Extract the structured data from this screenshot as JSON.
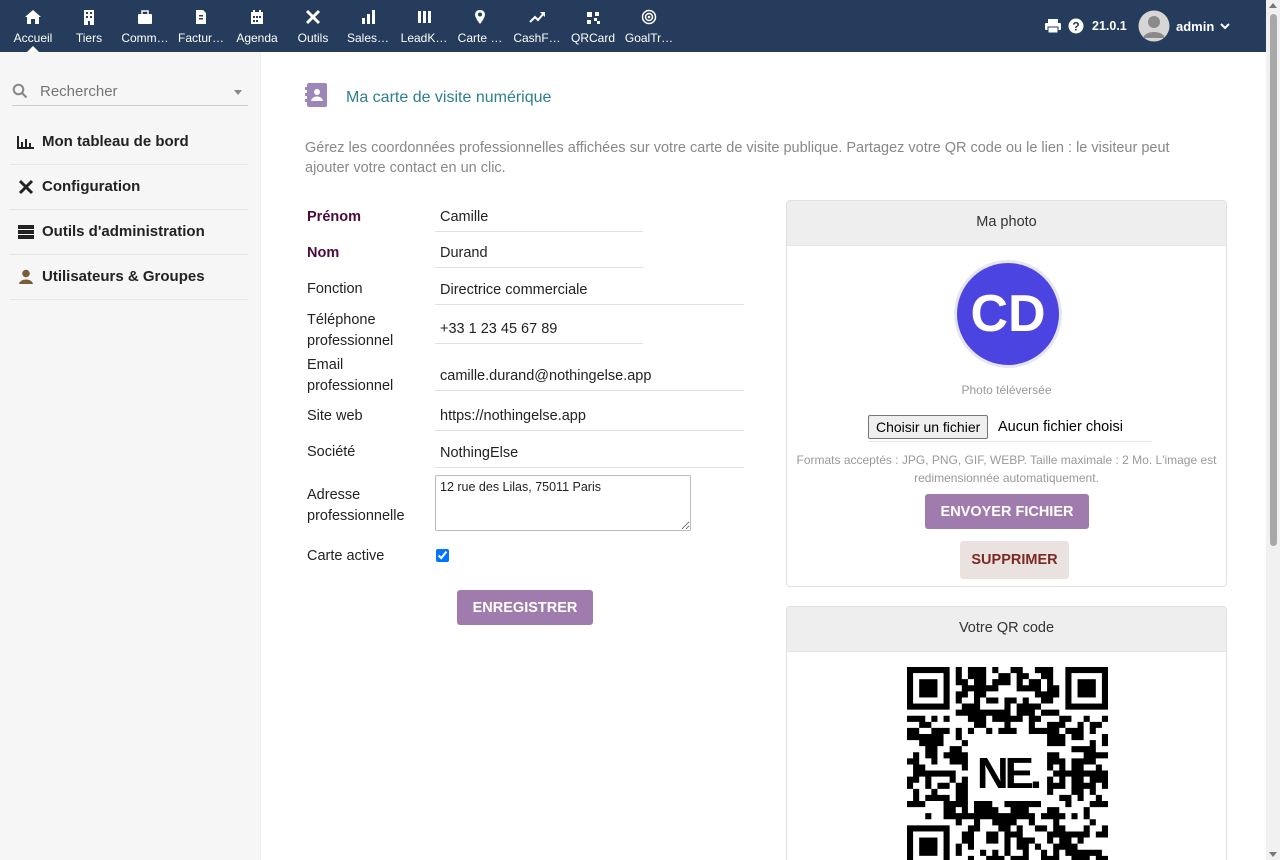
{
  "topbar": {
    "nav": [
      {
        "label": "Accueil",
        "icon": "home-icon"
      },
      {
        "label": "Tiers",
        "icon": "building-icon"
      },
      {
        "label": "Comm…",
        "icon": "briefcase-icon"
      },
      {
        "label": "Factur…",
        "icon": "invoice-icon"
      },
      {
        "label": "Agenda",
        "icon": "calendar-icon"
      },
      {
        "label": "Outils",
        "icon": "tools-icon"
      },
      {
        "label": "Sales…",
        "icon": "bar-chart-icon"
      },
      {
        "label": "LeadK…",
        "icon": "columns-icon"
      },
      {
        "label": "Carte …",
        "icon": "map-pin-icon"
      },
      {
        "label": "CashF…",
        "icon": "trend-icon"
      },
      {
        "label": "QRCard",
        "icon": "qr-icon"
      },
      {
        "label": "GoalTr…",
        "icon": "target-icon"
      }
    ],
    "version": "21.0.1",
    "user": "admin"
  },
  "sidebar": {
    "search_placeholder": "Rechercher",
    "items": [
      {
        "label": "Mon tableau de bord",
        "icon": "dashboard-icon"
      },
      {
        "label": "Configuration",
        "icon": "tools-icon"
      },
      {
        "label": "Outils d'administration",
        "icon": "server-icon"
      },
      {
        "label": "Utilisateurs & Groupes",
        "icon": "user-icon"
      }
    ]
  },
  "page": {
    "title": "Ma carte de visite numérique",
    "description": "Gérez les coordonnées professionnelles affichées sur votre carte de visite publique. Partagez votre QR code ou le lien : le visiteur peut ajouter votre contact en un clic."
  },
  "form": {
    "prenom": {
      "label": "Prénom",
      "value": "Camille"
    },
    "nom": {
      "label": "Nom",
      "value": "Durand"
    },
    "fonction": {
      "label": "Fonction",
      "value": "Directrice commerciale"
    },
    "telephone": {
      "label1": "Téléphone",
      "label2": "professionnel",
      "value": "+33 1 23 45 67 89"
    },
    "email": {
      "label1": "Email",
      "label2": "professionnel",
      "value": "camille.durand@nothingelse.app"
    },
    "site": {
      "label": "Site web",
      "value": "https://nothingelse.app"
    },
    "societe": {
      "label": "Société",
      "value": "NothingElse"
    },
    "adresse": {
      "label1": "Adresse",
      "label2": "professionnelle",
      "value": "12 rue des Lilas, 75011 Paris"
    },
    "active": {
      "label": "Carte active",
      "checked": true
    },
    "save_label": "ENREGISTRER"
  },
  "photo_card": {
    "header": "Ma photo",
    "initials": "CD",
    "avatar_color": "#4c44e0",
    "caption": "Photo téléversée",
    "choose_label": "Choisir un fichier",
    "no_file": "Aucun fichier choisi",
    "formats": "Formats acceptés : JPG, PNG, GIF, WEBP. Taille maximale : 2 Mo. L'image est redimensionnée automatiquement.",
    "upload_label": "ENVOYER FICHIER",
    "delete_label": "SUPPRIMER"
  },
  "qr_card": {
    "header": "Votre QR code",
    "logo_text": "NE."
  },
  "colors": {
    "topbar": "#263c5c",
    "accent_button": "#a07cae",
    "title": "#2d7f8f",
    "required_label": "#4a0a3a"
  }
}
